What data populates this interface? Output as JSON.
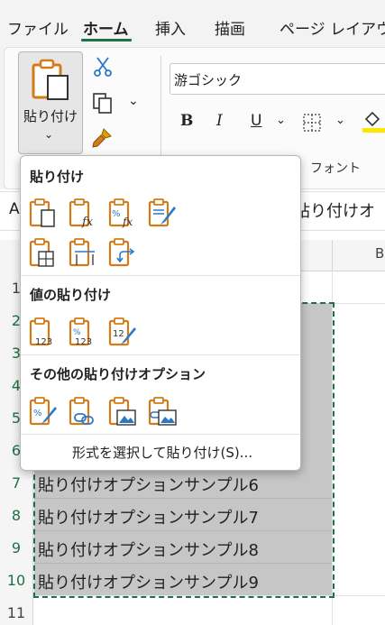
{
  "ribbon_tabs": {
    "file": "ファイル",
    "home": "ホーム",
    "insert": "挿入",
    "draw": "描画",
    "page_layout": "ページ レイアウ"
  },
  "clipboard": {
    "paste_label": "貼り付け"
  },
  "font": {
    "font_name": "游ゴシック",
    "bold": "B",
    "italic": "I",
    "underline": "U",
    "group_label": "フォント"
  },
  "formula_bar": {
    "namebox_peek": "A",
    "formula_peek": "貼り付けオ"
  },
  "grid": {
    "column_b": "B",
    "row_numbers": [
      "1",
      "2",
      "3",
      "4",
      "5",
      "6",
      "7",
      "8",
      "9",
      "10",
      "11"
    ],
    "cells": [
      "貼り付けオプションサンプル6",
      "貼り付けオプションサンプル7",
      "貼り付けオプションサンプル8",
      "貼り付けオプションサンプル9"
    ]
  },
  "paste_menu": {
    "section_paste": "貼り付け",
    "section_values": "値の貼り付け",
    "section_other": "その他の貼り付けオプション",
    "paste_special": "形式を選択して貼り付け(S)...",
    "paste_icons": [
      "paste-icon",
      "paste-formulas-icon",
      "paste-formulas-number-format-icon",
      "paste-keep-source-formatting-icon",
      "paste-no-borders-icon",
      "paste-keep-column-widths-icon",
      "paste-transpose-icon"
    ],
    "value_icons": [
      "paste-values-icon",
      "paste-values-number-format-icon",
      "paste-values-source-formatting-icon"
    ],
    "other_icons": [
      "paste-formatting-icon",
      "paste-link-icon",
      "paste-picture-icon",
      "paste-linked-picture-icon"
    ]
  },
  "colors": {
    "accent": "#1e7145",
    "clipboard_orange": "#d47b1a",
    "icon_blue": "#2b78c5",
    "selection": "#c6c6c6"
  }
}
